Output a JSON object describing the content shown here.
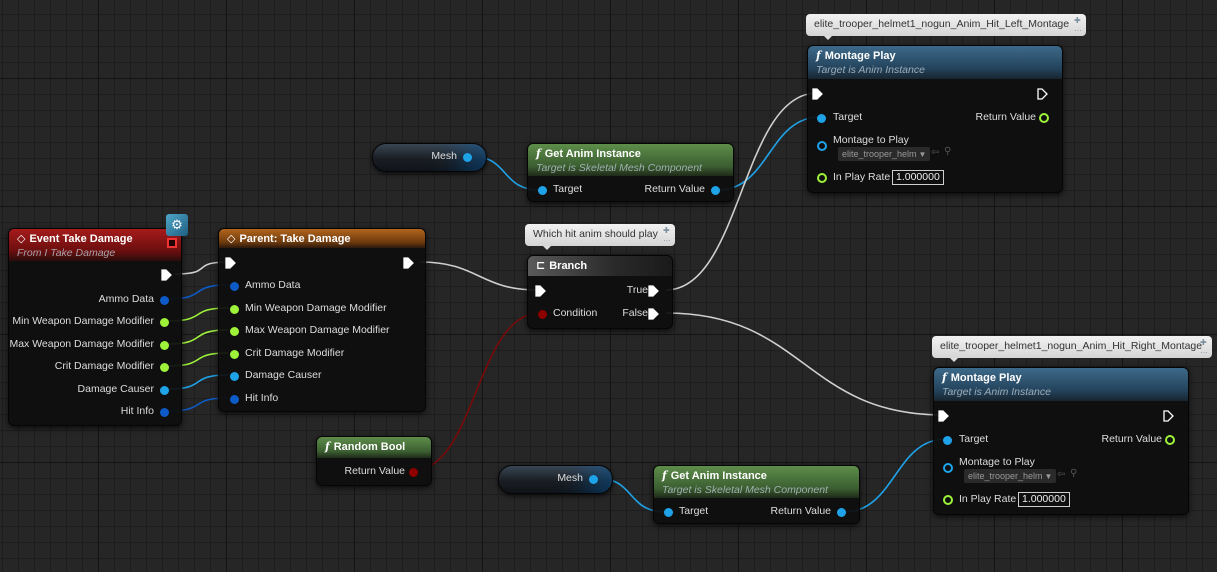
{
  "colors": {
    "exec": "#ffffff",
    "object": "#1fa3e8",
    "struct": "#0d5bc7",
    "float": "#9ef23a",
    "bool": "#8c0000",
    "event_header": "#8e1414",
    "parent_header": "#8a4b12",
    "pure_header": "#4d7a3e",
    "function_header": "#2f5a7a",
    "branch_header": "#3a3a3a"
  },
  "nodes": {
    "event": {
      "title": "Event Take Damage",
      "subtitle": "From I Take Damage",
      "icon": "event-diamond-icon",
      "pins": [
        "Ammo Data",
        "Min Weapon Damage Modifier",
        "Max Weapon Damage Modifier",
        "Crit Damage Modifier",
        "Damage Causer",
        "Hit Info"
      ]
    },
    "parent": {
      "title": "Parent: Take Damage",
      "icon": "event-diamond-icon",
      "pins": [
        "Ammo Data",
        "Min Weapon Damage Modifier",
        "Max Weapon Damage Modifier",
        "Crit Damage Modifier",
        "Damage Causer",
        "Hit Info"
      ]
    },
    "mesh1": {
      "label": "Mesh"
    },
    "mesh2": {
      "label": "Mesh"
    },
    "getanim1": {
      "title": "Get Anim Instance",
      "subtitle": "Target is Skeletal Mesh Component",
      "in": "Target",
      "out": "Return Value"
    },
    "getanim2": {
      "title": "Get Anim Instance",
      "subtitle": "Target is Skeletal Mesh Component",
      "in": "Target",
      "out": "Return Value"
    },
    "branch": {
      "title": "Branch",
      "comment": "Which hit anim should play",
      "condition": "Condition",
      "true": "True",
      "false": "False"
    },
    "random": {
      "title": "Random Bool",
      "out": "Return Value"
    },
    "montage1": {
      "title": "Montage Play",
      "subtitle": "Target is Anim Instance",
      "comment": "elite_trooper_helmet1_nogun_Anim_Hit_Left_Montage",
      "target": "Target",
      "return": "Return Value",
      "montage_label": "Montage to Play",
      "montage_value": "elite_trooper_helm",
      "rate_label": "In Play Rate",
      "rate_value": "1.000000"
    },
    "montage2": {
      "title": "Montage Play",
      "subtitle": "Target is Anim Instance",
      "comment": "elite_trooper_helmet1_nogun_Anim_Hit_Right_Montage",
      "target": "Target",
      "return": "Return Value",
      "montage_label": "Montage to Play",
      "montage_value": "elite_trooper_helm",
      "rate_label": "In Play Rate",
      "rate_value": "1.000000"
    }
  }
}
